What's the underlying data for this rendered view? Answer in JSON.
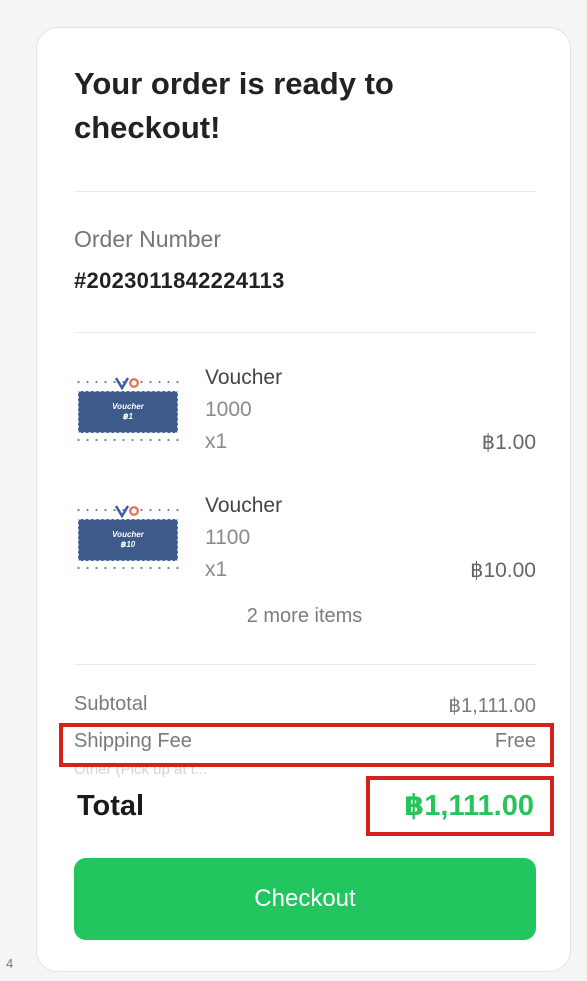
{
  "title": "Your order is ready to checkout!",
  "order": {
    "label": "Order Number",
    "number": "#2023011842224113"
  },
  "items": [
    {
      "name": "Voucher",
      "variant": "1000",
      "quantity": "x1",
      "price": "฿1.00",
      "thumb_text_1": "Voucher",
      "thumb_text_2": "฿1"
    },
    {
      "name": "Voucher",
      "variant": "1100",
      "quantity": "x1",
      "price": "฿10.00",
      "thumb_text_1": "Voucher",
      "thumb_text_2": "฿10"
    }
  ],
  "more_items": "2 more items",
  "summary": {
    "subtotal_label": "Subtotal",
    "subtotal_value": "฿1,111.00",
    "shipping_label": "Shipping Fee",
    "shipping_value": "Free",
    "shipping_note": "Other (Pick up at t...",
    "total_label": "Total",
    "total_value": "฿1,111.00"
  },
  "checkout_label": "Checkout",
  "corner_number": "4",
  "colors": {
    "accent_green": "#22c55e",
    "highlight_red": "#d6201c",
    "voucher_blue": "#3e5a8a"
  }
}
